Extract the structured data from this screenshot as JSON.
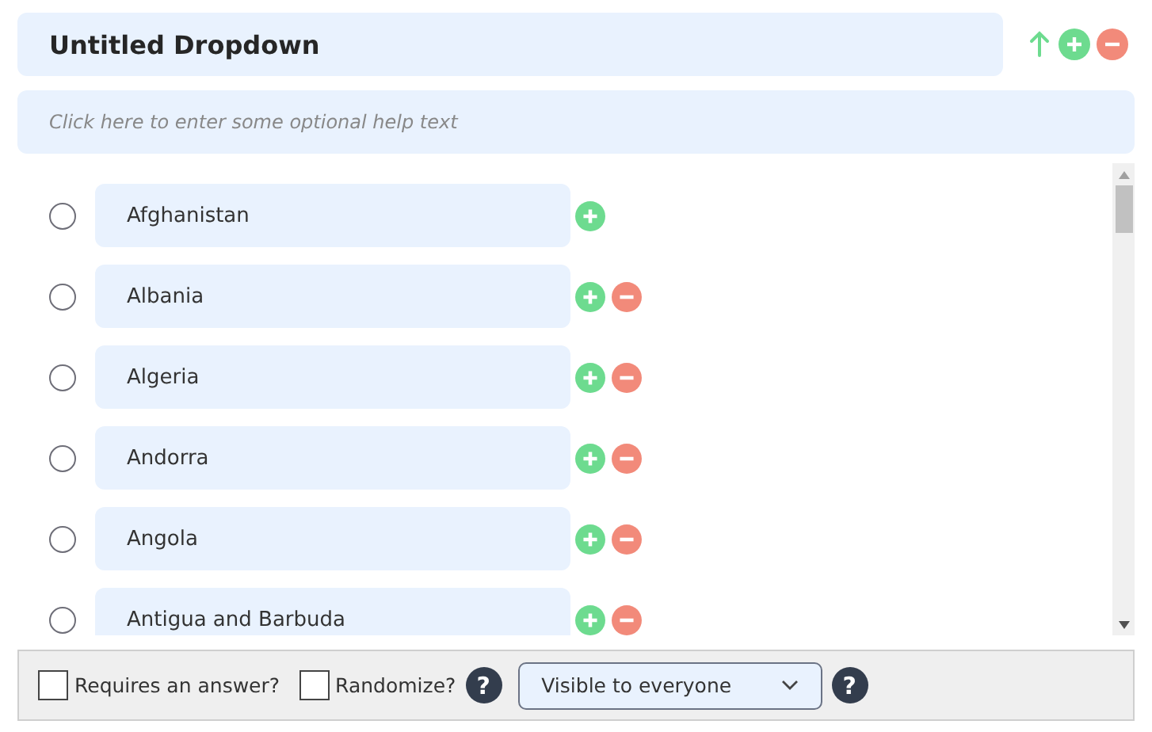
{
  "title": "Untitled Dropdown",
  "help_text": {
    "placeholder": "Click here to enter some optional help text"
  },
  "options": [
    {
      "label": "Afghanistan",
      "selected": false,
      "removable": false
    },
    {
      "label": "Albania",
      "selected": false,
      "removable": true
    },
    {
      "label": "Algeria",
      "selected": false,
      "removable": true
    },
    {
      "label": "Andorra",
      "selected": false,
      "removable": true
    },
    {
      "label": "Angola",
      "selected": false,
      "removable": true
    },
    {
      "label": "Antigua and Barbuda",
      "selected": false,
      "removable": true
    }
  ],
  "footer": {
    "requires_answer": {
      "label": "Requires an answer?",
      "checked": false
    },
    "randomize": {
      "label": "Randomize?",
      "checked": false
    },
    "help_glyphs": [
      "?",
      "?"
    ],
    "visibility": {
      "value": "Visible to everyone"
    }
  }
}
